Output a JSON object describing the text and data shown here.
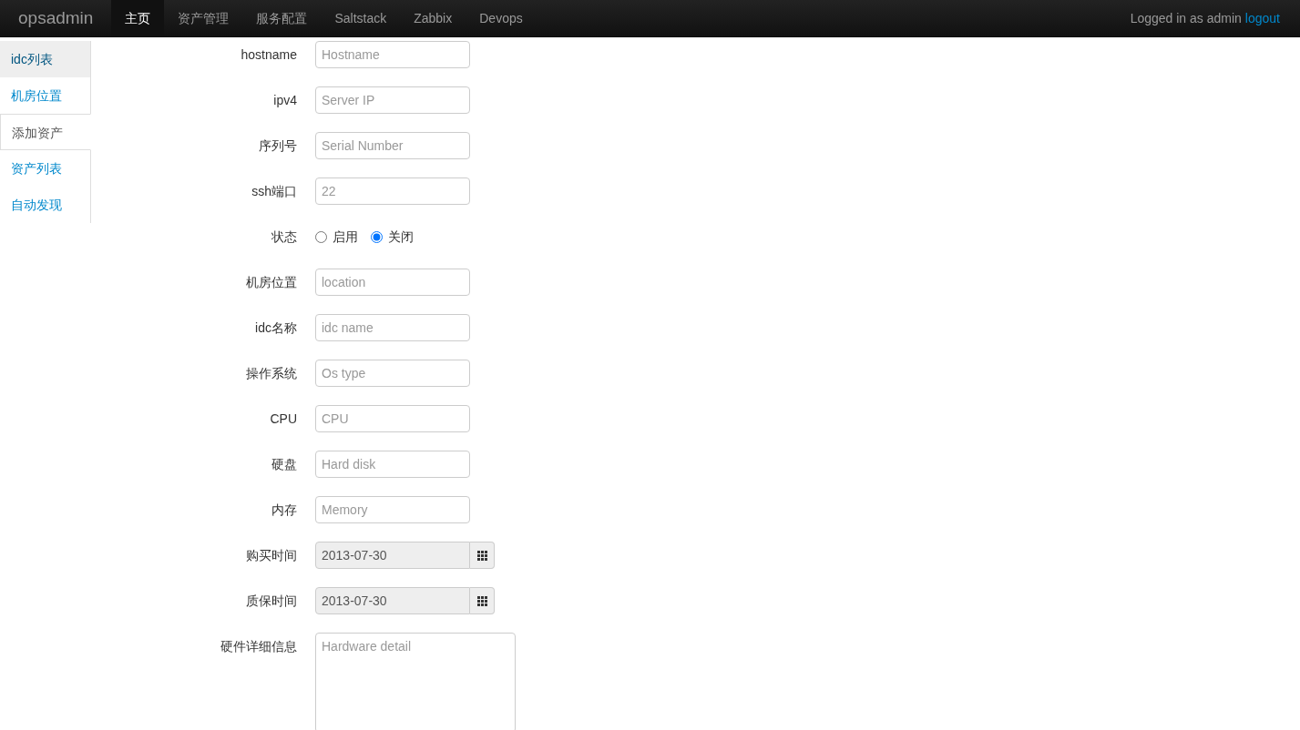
{
  "navbar": {
    "brand": "opsadmin",
    "items": [
      {
        "label": "主页",
        "selected": true
      },
      {
        "label": "资产管理",
        "selected": false
      },
      {
        "label": "服务配置",
        "selected": false
      },
      {
        "label": "Saltstack",
        "selected": false
      },
      {
        "label": "Zabbix",
        "selected": false
      },
      {
        "label": "Devops",
        "selected": false
      }
    ],
    "login_text": "Logged in as admin",
    "logout": "logout"
  },
  "sidebar": {
    "items": [
      {
        "label": "idc列表",
        "selected": false,
        "hovered": true
      },
      {
        "label": "机房位置",
        "selected": false,
        "hovered": false
      },
      {
        "label": "添加资产",
        "selected": true,
        "hovered": false
      },
      {
        "label": "资产列表",
        "selected": false,
        "hovered": false
      },
      {
        "label": "自动发现",
        "selected": false,
        "hovered": false
      }
    ]
  },
  "form": {
    "fields": [
      {
        "kind": "text",
        "label": "hostname",
        "placeholder": "Hostname"
      },
      {
        "kind": "text",
        "label": "ipv4",
        "placeholder": "Server IP"
      },
      {
        "kind": "text",
        "label": "序列号",
        "placeholder": "Serial Number"
      },
      {
        "kind": "text",
        "label": "ssh端口",
        "placeholder": "22"
      },
      {
        "kind": "radio",
        "label": "状态",
        "options": [
          {
            "label": "启用",
            "selected": false
          },
          {
            "label": "关闭",
            "selected": true
          }
        ]
      },
      {
        "kind": "text",
        "label": "机房位置",
        "placeholder": "location"
      },
      {
        "kind": "text",
        "label": "idc名称",
        "placeholder": "idc name"
      },
      {
        "kind": "text",
        "label": "操作系统",
        "placeholder": "Os type"
      },
      {
        "kind": "text",
        "label": "CPU",
        "placeholder": "CPU"
      },
      {
        "kind": "text",
        "label": "硬盘",
        "placeholder": "Hard disk"
      },
      {
        "kind": "text",
        "label": "内存",
        "placeholder": "Memory"
      },
      {
        "kind": "date",
        "label": "购买时间",
        "value": "2013-07-30"
      },
      {
        "kind": "date",
        "label": "质保时间",
        "value": "2013-07-30"
      },
      {
        "kind": "textarea",
        "label": "硬件详细信息",
        "placeholder": "Hardware detail"
      }
    ]
  }
}
